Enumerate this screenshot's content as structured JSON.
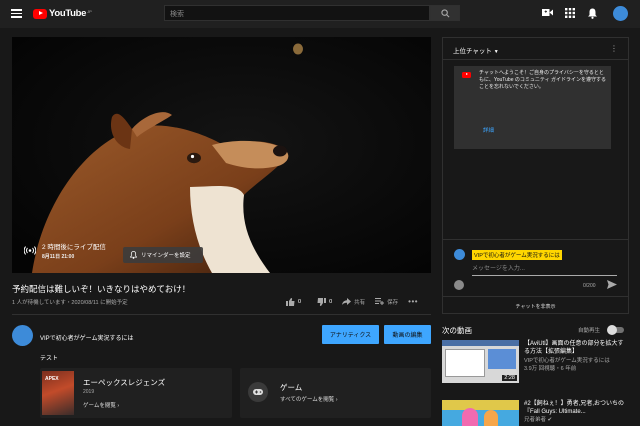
{
  "header": {
    "logo_text": "YouTube",
    "logo_region": "JP",
    "search_placeholder": "検索"
  },
  "player": {
    "live_label": "2 時間後にライブ配信",
    "live_date": "8月11日 21:00",
    "reminder_label": "リマインダーを設定"
  },
  "video": {
    "title": "予約配信は難しいぞ！いきなりはやめておけ！",
    "meta": "1 人が待機しています・2020/08/11 に開始予定",
    "likes": "0",
    "dislikes": "0",
    "share_label": "共有",
    "save_label": "保存"
  },
  "channel": {
    "name": "VIPで初心者がゲーム実況するには",
    "analytics_label": "アナリティクス",
    "edit_label": "動画の編集",
    "description": "テスト"
  },
  "game": {
    "thumb_text": "APEX",
    "title": "エーペックスレジェンズ",
    "year": "2019",
    "browse_label": "ゲームを閲覧",
    "category_title": "ゲーム",
    "category_browse": "すべてのゲームを閲覧"
  },
  "chat": {
    "title": "上位チャット",
    "notice": "チャットへようこそ！ご自身のプライバシーを守るとともに、YouTube のコミュニティ ガイドラインを遵守することを忘れないでください。",
    "notice_link": "詳細",
    "user_name": "VIPで初心者がゲーム実況するには",
    "input_placeholder": "メッセージを入力...",
    "char_count": "0/200",
    "hide_label": "チャットを非表示"
  },
  "up_next": {
    "label": "次の動画",
    "autoplay_label": "自動再生",
    "videos": [
      {
        "title": "【AviUtl】画面の任意の部分を拡大する方法【拡張編集】",
        "channel": "VIPで初心者がゲーム実況するには",
        "views": "3.9万 回視聴・6 年前",
        "duration": "2:28"
      },
      {
        "title": "#2【飼ねぇ！】勇者,兄者,おついちの『Fall Guys: Ultimate...",
        "channel": "兄者弟者",
        "views": ""
      }
    ]
  }
}
